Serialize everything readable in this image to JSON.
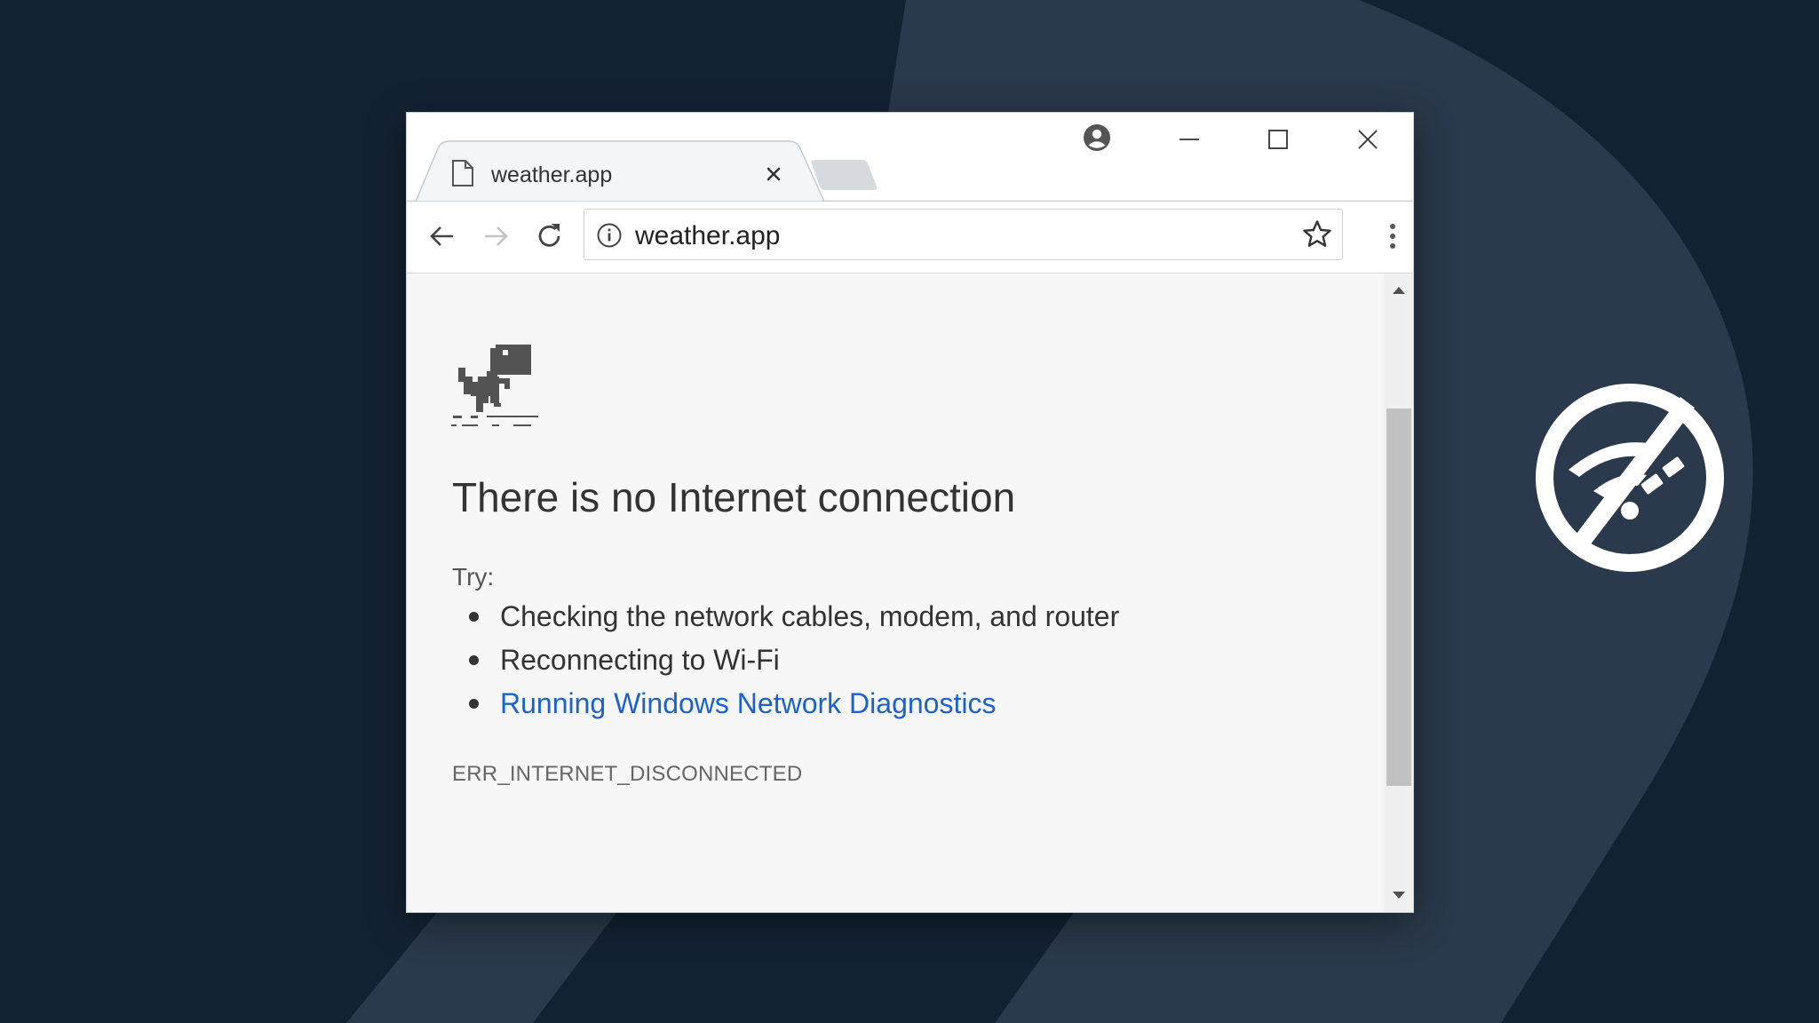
{
  "background": {
    "color": "#132233",
    "shape_color": "#2a394b"
  },
  "browser": {
    "tab": {
      "title": "weather.app",
      "icon": "page-icon"
    },
    "new_tab_icon": "new-tab-icon",
    "window_controls": {
      "profile_icon": "profile-icon",
      "minimize_icon": "minimize-icon",
      "maximize_icon": "maximize-icon",
      "close_icon": "close-icon"
    },
    "toolbar": {
      "back_icon": "back-arrow-icon",
      "forward_icon": "forward-arrow-icon",
      "reload_icon": "reload-icon",
      "address": "weather.app",
      "info_icon": "info-icon",
      "bookmark_icon": "star-icon",
      "menu_icon": "three-dots-menu-icon"
    }
  },
  "error_page": {
    "title": "There is no Internet connection",
    "try_label": "Try:",
    "suggestions": [
      "Checking the network cables, modem, and router",
      "Reconnecting to Wi-Fi",
      "Running Windows Network Diagnostics"
    ],
    "error_code": "ERR_INTERNET_DISCONNECTED",
    "link_color": "#1a62cc"
  },
  "overlay_icon": "no-wifi-icon"
}
